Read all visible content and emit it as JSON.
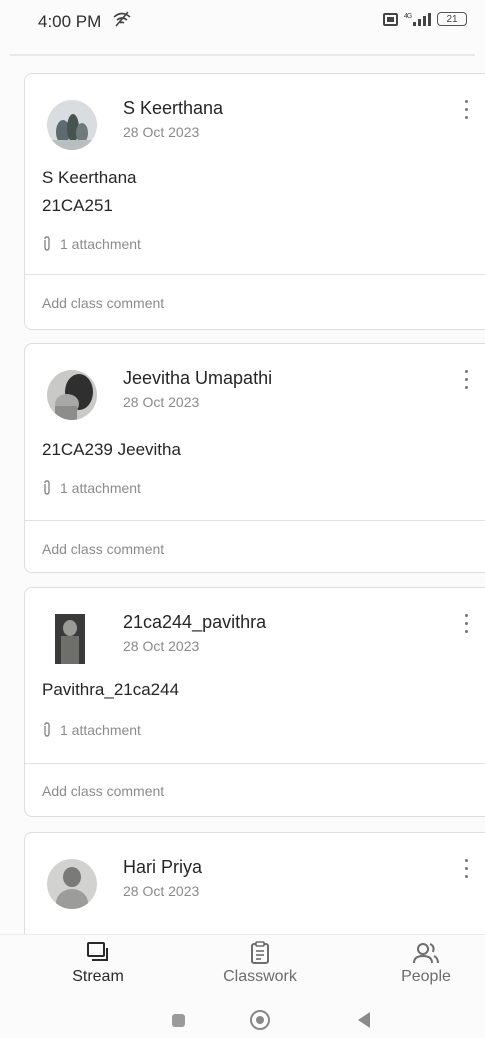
{
  "status_bar": {
    "time": "4:00 PM",
    "battery": "21",
    "network": "4G"
  },
  "posts": [
    {
      "author": "S Keerthana",
      "date": "28 Oct 2023",
      "text_line1": "S Keerthana",
      "text_line2": "21CA251",
      "attachment": "1 attachment",
      "comment_placeholder": "Add class comment"
    },
    {
      "author": "Jeevitha Umapathi",
      "date": "28 Oct 2023",
      "text_line1": "21CA239 Jeevitha",
      "attachment": "1 attachment",
      "comment_placeholder": "Add class comment"
    },
    {
      "author": "21ca244_pavithra",
      "date": "28 Oct 2023",
      "text_line1": "Pavithra_21ca244",
      "attachment": "1 attachment",
      "comment_placeholder": "Add class comment"
    },
    {
      "author": "Hari Priya",
      "date": "28 Oct 2023"
    }
  ],
  "bottom_nav": {
    "stream": "Stream",
    "classwork": "Classwork",
    "people": "People"
  },
  "icons": {
    "stream": "stream-icon",
    "classwork": "classwork-icon",
    "people": "people-icon",
    "attachment": "paperclip-icon",
    "more": "more-vert-icon"
  }
}
